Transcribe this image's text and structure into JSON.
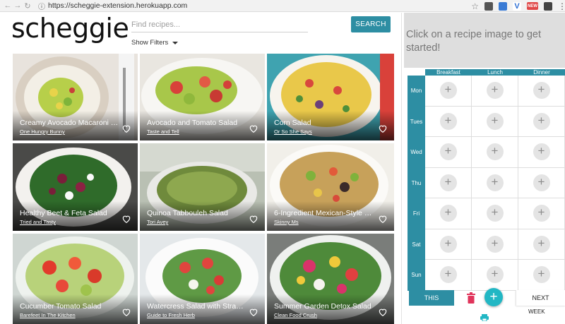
{
  "browser": {
    "url": "https://scheggie-extension.herokuapp.com",
    "extension_badge": "NEW"
  },
  "header": {
    "logo": "scheggie",
    "search_placeholder": "Find recipes...",
    "search_button": "SEARCH",
    "filters_label": "Show Filters"
  },
  "recipes": [
    {
      "title": "Creamy Avocado Macaroni S...",
      "source": "One Hungry Bunny"
    },
    {
      "title": "Avocado and Tomato Salad",
      "source": "Taste and Tell"
    },
    {
      "title": "Corn Salad",
      "source": "Or So She Says"
    },
    {
      "title": "Healthy Beet & Feta Salad",
      "source": "Tried and Tasty"
    },
    {
      "title": "Quinoa Tabbouleh Salad",
      "source": "Tori Avey"
    },
    {
      "title": "6-Ingredient Mexican-Style Q...",
      "source": "Skinny Ms"
    },
    {
      "title": "Cucumber Tomato Salad",
      "source": "Barefeet In The Kitchen"
    },
    {
      "title": "Watercress Salad with Straw...",
      "source": "Guide to Fresh Herb"
    },
    {
      "title": "Summer Garden Detox Salad",
      "source": "Clean Food Crush"
    }
  ],
  "planner": {
    "prompt": "Click on a recipe image to get started!",
    "meals": [
      "Breakfast",
      "Lunch",
      "Dinner"
    ],
    "days": [
      "Mon",
      "Tues",
      "Wed",
      "Thu",
      "Fri",
      "Sat",
      "Sun"
    ],
    "this_week_label": "THIS",
    "next_label": "NEXT",
    "week_label": "WEEK",
    "add_symbol": "+"
  },
  "colors": {
    "accent": "#2d8ea3",
    "fab": "#22b7c4",
    "trash": "#e0345b"
  }
}
